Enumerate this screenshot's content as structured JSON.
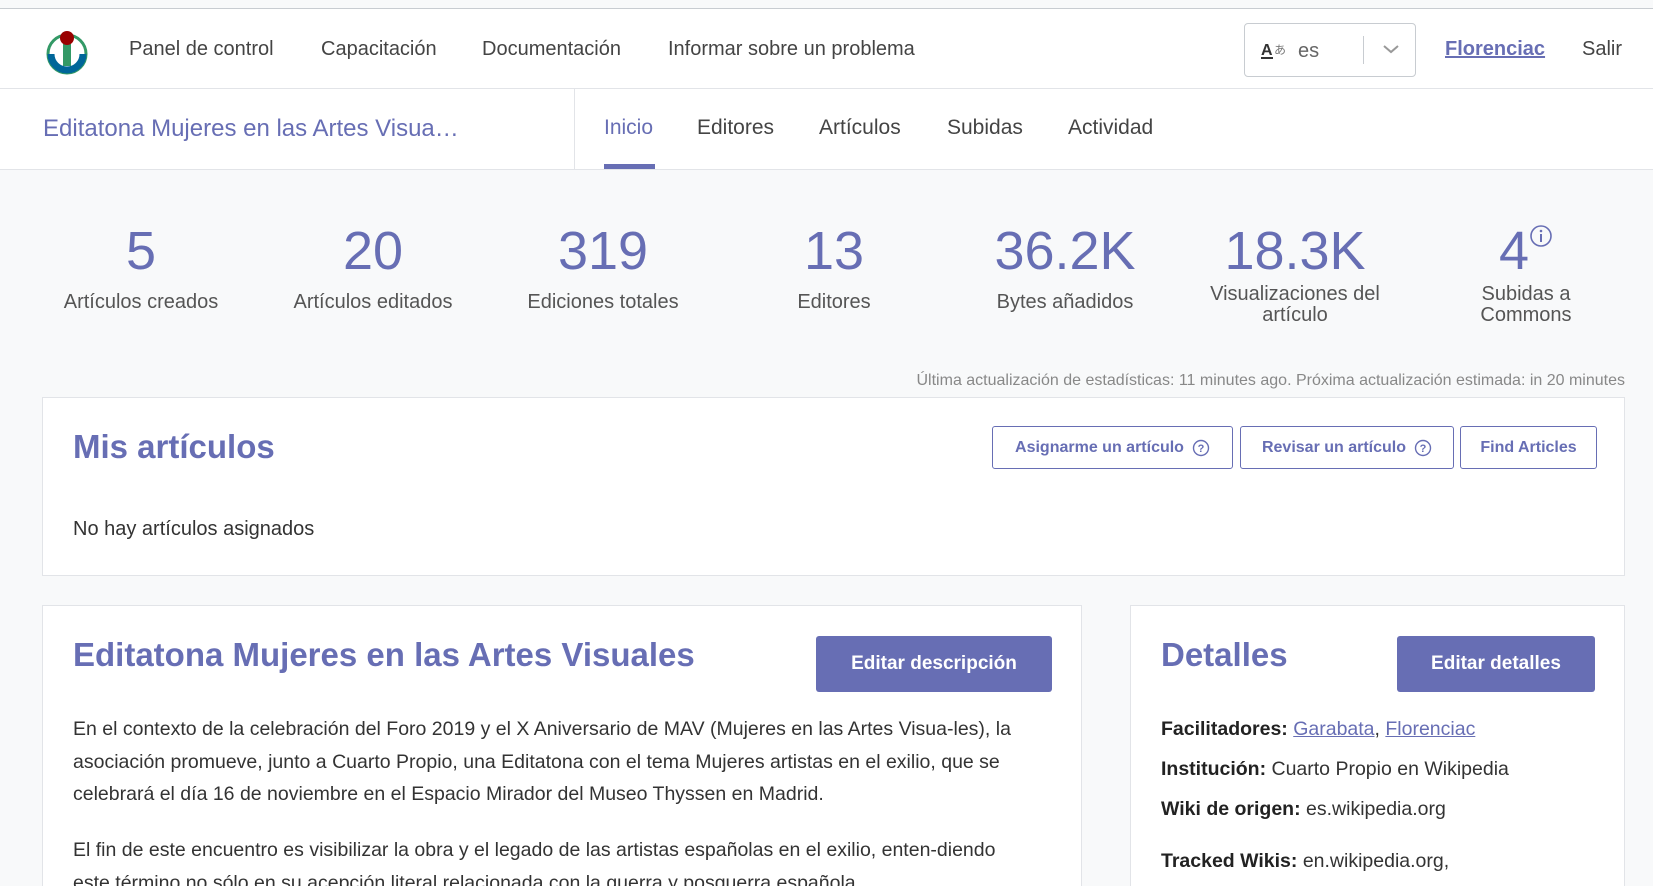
{
  "topnav": {
    "links": [
      "Panel de control",
      "Capacitación",
      "Documentación",
      "Informar sobre un problema"
    ],
    "language": "es",
    "user": "Florenciac",
    "logout": "Salir"
  },
  "course": {
    "title": "Editatona Mujeres en las Artes Visua…",
    "tabs": [
      "Inicio",
      "Editores",
      "Artículos",
      "Subidas",
      "Actividad"
    ],
    "active_tab": "Inicio"
  },
  "stats": [
    {
      "value": "5",
      "label": "Artículos creados"
    },
    {
      "value": "20",
      "label": "Artículos editados"
    },
    {
      "value": "319",
      "label": "Ediciones totales"
    },
    {
      "value": "13",
      "label": "Editores"
    },
    {
      "value": "36.2K",
      "label": "Bytes añadidos"
    },
    {
      "value": "18.3K",
      "label": "Visualizaciones del artículo"
    },
    {
      "value": "4",
      "label": "Subidas a Commons"
    }
  ],
  "stats_updated": "Última actualización de estadísticas: 11 minutes ago. Próxima actualización estimada: in 20 minutes",
  "my_articles": {
    "heading": "Mis artículos",
    "assign_btn": "Asignarme un artículo",
    "review_btn": "Revisar un artículo",
    "find_btn": "Find Articles",
    "empty": "No hay artículos asignados"
  },
  "description": {
    "heading": "Editatona Mujeres en las Artes Visuales",
    "edit_btn": "Editar descripción",
    "p1": "En el contexto de la celebración del Foro 2019 y el X Aniversario de MAV (Mujeres en las Artes Visua-les), la asociación promueve, junto a Cuarto Propio, una Editatona con el tema Mujeres artistas en el exilio, que se celebrará el día 16 de noviembre en el Espacio Mirador del Museo Thyssen en Madrid.",
    "p2": "El fin de este encuentro es visibilizar la obra y el legado de las artistas españolas en el exilio, enten-diendo este término no sólo en su acepción literal relacionada con la guerra y posguerra española"
  },
  "details": {
    "heading": "Detalles",
    "edit_btn": "Editar detalles",
    "facilitators_label": "Facilitadores:",
    "facilitator_1": "Garabata",
    "facilitator_sep": ",",
    "facilitator_2": "Florenciac",
    "institution_label": "Institución:",
    "institution": "Cuarto Propio en Wikipedia",
    "home_wiki_label": "Wiki de origen:",
    "home_wiki": "es.wikipedia.org",
    "tracked_label": "Tracked Wikis:",
    "tracked": "en.wikipedia.org,"
  },
  "colors": {
    "accent": "#676eb4",
    "background": "#f8f9fa"
  }
}
